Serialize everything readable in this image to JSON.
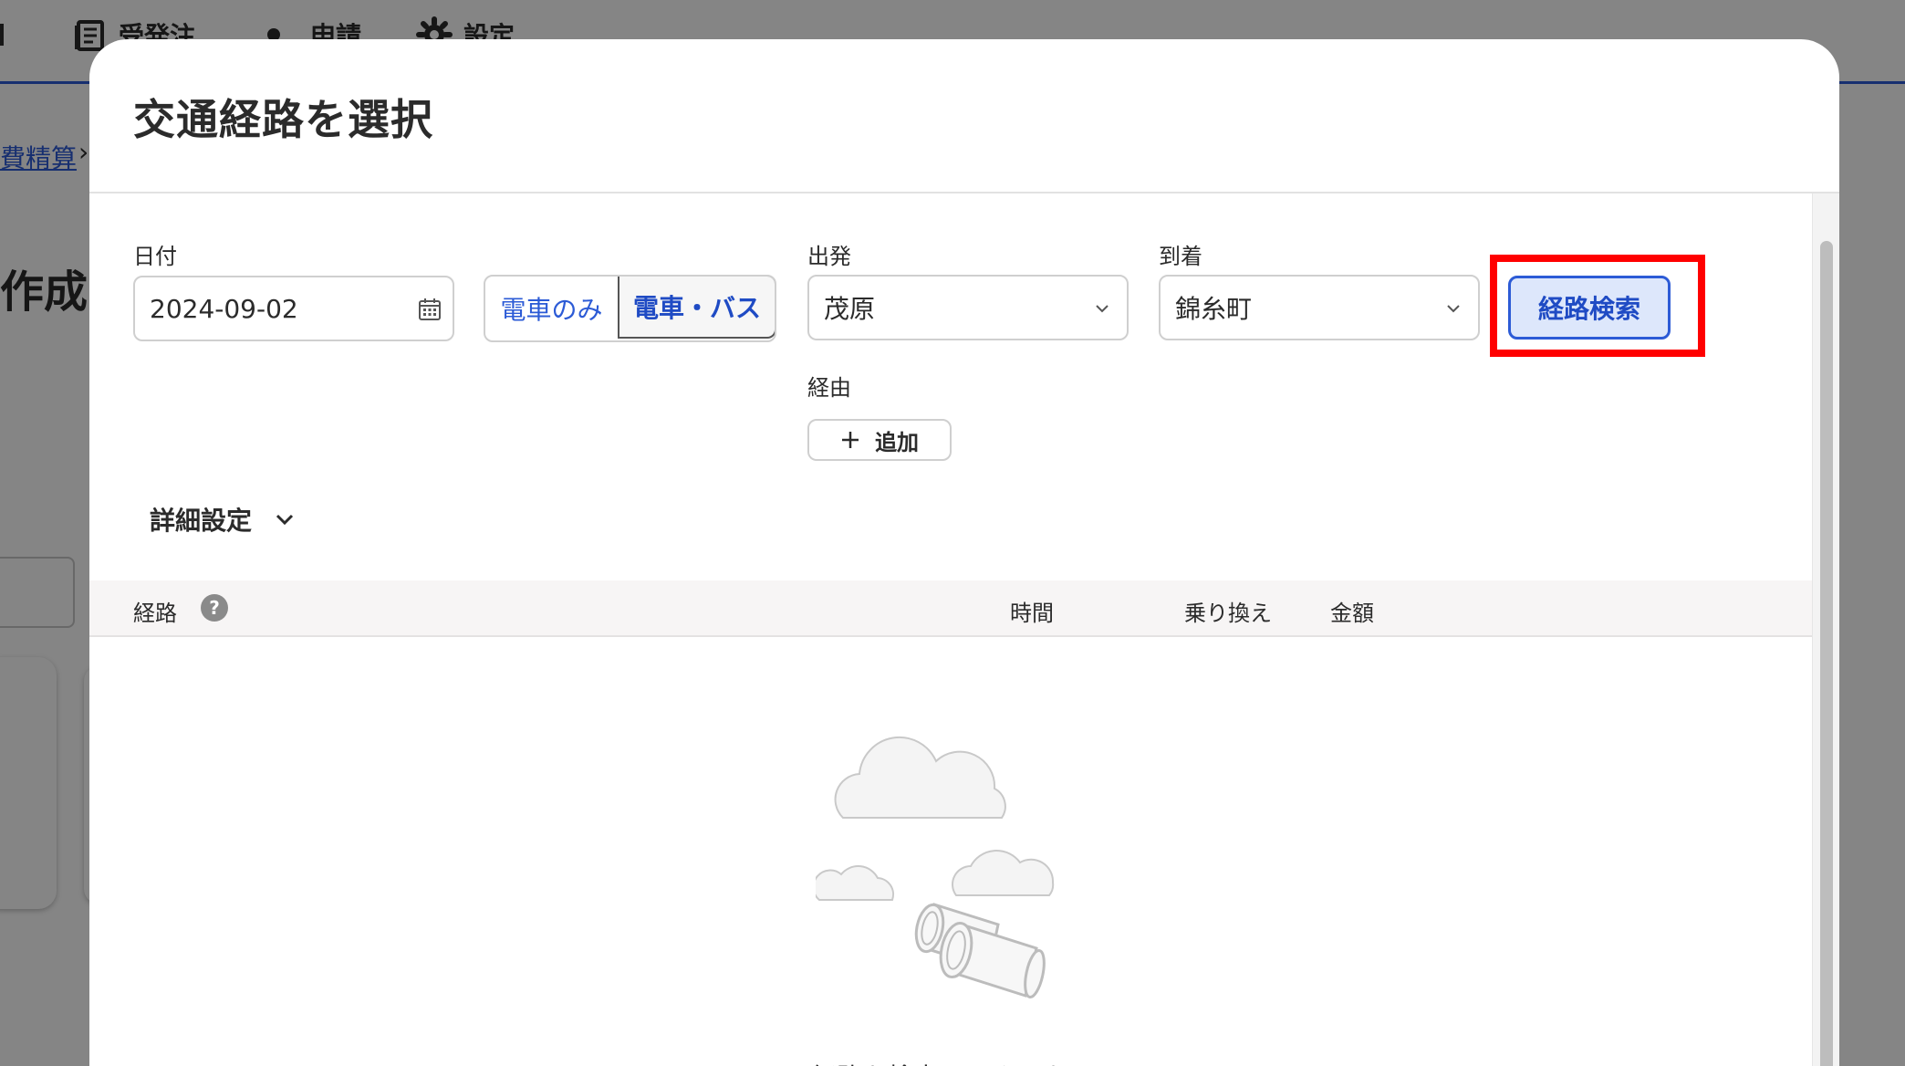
{
  "background": {
    "nav": [
      {
        "label": "受発注",
        "icon": "document-list-icon"
      },
      {
        "label": "申請",
        "icon": "dot-icon"
      },
      {
        "label": "設定",
        "icon": "gear-icon"
      }
    ],
    "breadcrumb_text": "費精算",
    "breadcrumb_sep": "›",
    "page_title": "作成"
  },
  "modal": {
    "title": "交通経路を選択",
    "date": {
      "label": "日付",
      "value": "2024-09-02"
    },
    "transport_mode": {
      "options": [
        "電車のみ",
        "電車・バス"
      ],
      "selected": "電車・バス"
    },
    "departure": {
      "label": "出発",
      "value": "茂原"
    },
    "arrival": {
      "label": "到着",
      "value": "錦糸町"
    },
    "search_button": "経路検索",
    "via": {
      "label": "経由",
      "add_button": "追加"
    },
    "detail_settings": "詳細設定",
    "table": {
      "columns": {
        "route": "経路",
        "time": "時間",
        "transfers": "乗り換え",
        "fare": "金額"
      },
      "help_icon": "?"
    },
    "empty_message": "経路を検索してください"
  },
  "colors": {
    "accent": "#2c5bd6",
    "highlight": "#ff0000",
    "search_button_bg": "#dde7fb"
  }
}
